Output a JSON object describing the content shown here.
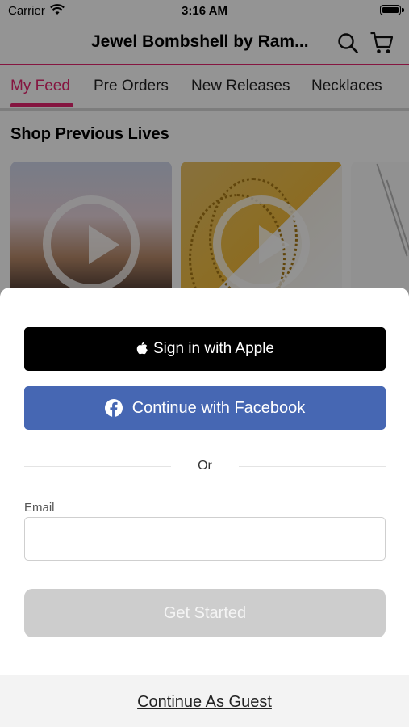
{
  "status_bar": {
    "carrier": "Carrier",
    "time": "3:16 AM"
  },
  "nav": {
    "title": "Jewel Bombshell by Ram..."
  },
  "tabs": [
    {
      "label": "My Feed",
      "active": true
    },
    {
      "label": "Pre Orders",
      "active": false
    },
    {
      "label": "New Releases",
      "active": false
    },
    {
      "label": "Necklaces",
      "active": false
    }
  ],
  "section": {
    "title": "Shop Previous Lives"
  },
  "sheet": {
    "apple_label": "Sign in with Apple",
    "facebook_label": "Continue with Facebook",
    "or_text": "Or",
    "email_label": "Email",
    "email_value": "",
    "get_started_label": "Get Started",
    "guest_label": "Continue As Guest"
  },
  "colors": {
    "accent": "#e5256e",
    "facebook": "#4667b3",
    "apple": "#000000",
    "disabled_button": "#cdcdcd"
  },
  "icons": [
    "wifi-icon",
    "battery-icon",
    "search-icon",
    "cart-icon",
    "play-icon",
    "apple-icon",
    "facebook-icon"
  ]
}
